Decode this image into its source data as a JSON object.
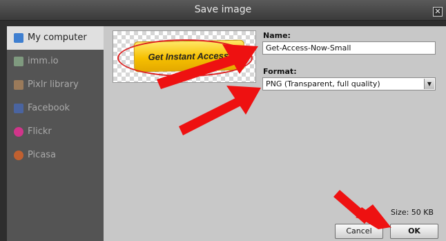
{
  "window": {
    "title": "Save image",
    "close_glyph": "✕"
  },
  "sidebar": {
    "items": [
      {
        "label": "My computer",
        "icon": "monitor-icon",
        "color": "#3f7fd0",
        "active": true
      },
      {
        "label": "imm.io",
        "icon": "image-icon",
        "color": "#7f9a7f",
        "active": false
      },
      {
        "label": "Pixlr library",
        "icon": "library-icon",
        "color": "#9a7a5a",
        "active": false
      },
      {
        "label": "Facebook",
        "icon": "facebook-icon",
        "color": "#4a64a0",
        "active": false
      },
      {
        "label": "Flickr",
        "icon": "flickr-icon",
        "color": "#d0358a",
        "active": false
      },
      {
        "label": "Picasa",
        "icon": "picasa-icon",
        "color": "#c06030",
        "active": false
      }
    ]
  },
  "preview": {
    "button_text": "Get Instant Access!"
  },
  "form": {
    "name_label": "Name:",
    "name_value": "Get-Access-Now-Small",
    "format_label": "Format:",
    "format_value": "PNG (Transparent, full quality)",
    "size_text": "Size: 50 KB"
  },
  "buttons": {
    "cancel": "Cancel",
    "ok": "OK"
  },
  "colors": {
    "annotation_arrow": "#ee1111"
  }
}
